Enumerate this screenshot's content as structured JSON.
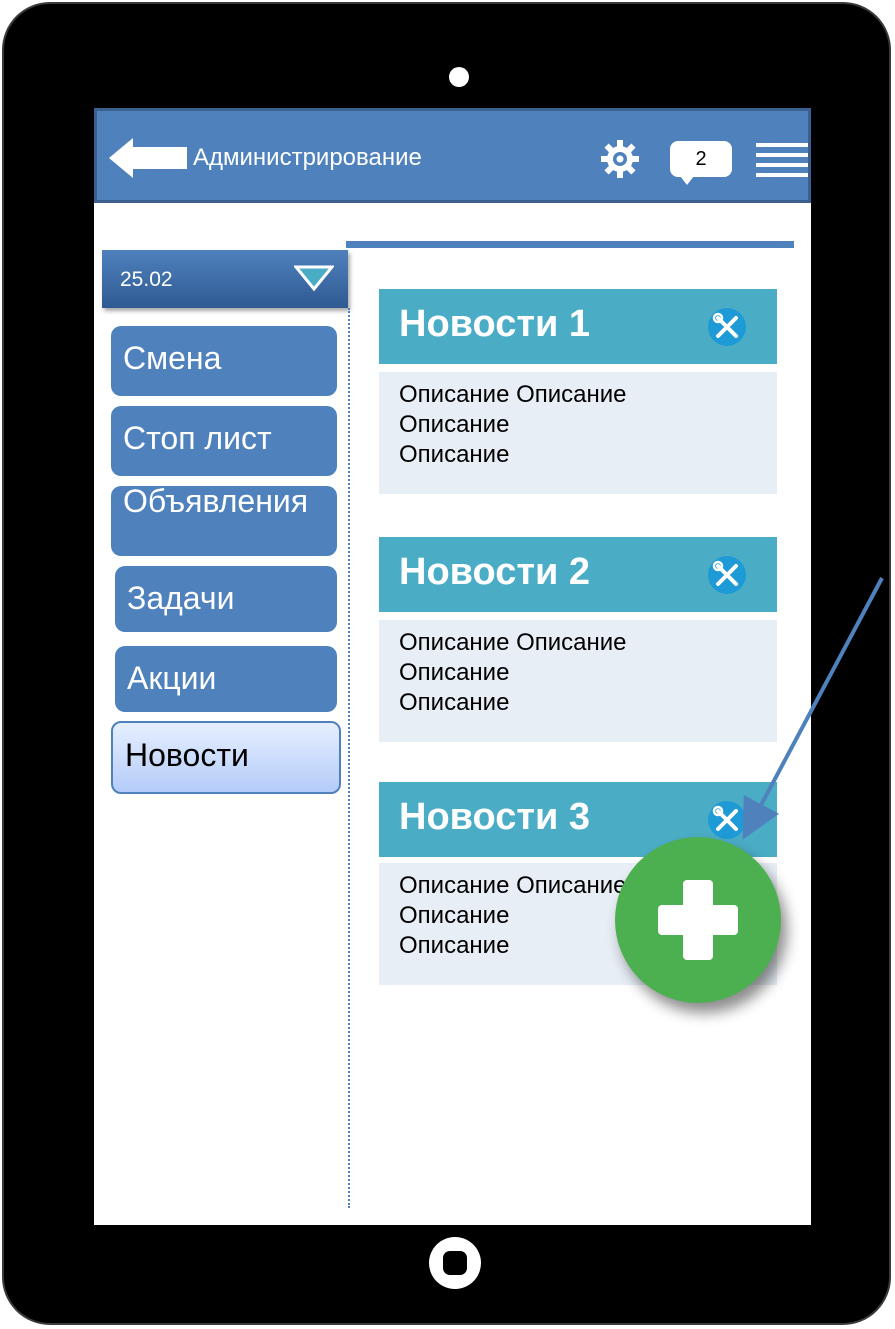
{
  "header": {
    "title": "Администрирование",
    "badge_count": "2",
    "icons": [
      "back-arrow-icon",
      "gear-icon",
      "chat-badge-icon",
      "hamburger-menu-icon"
    ]
  },
  "date_dropdown": {
    "selected": "25.02"
  },
  "sidebar": {
    "items": [
      {
        "label": "Смена"
      },
      {
        "label": "Стоп лист"
      },
      {
        "label": "Объявления"
      },
      {
        "label": "Задачи"
      },
      {
        "label": "Акции"
      },
      {
        "label": "Новости",
        "active": true
      }
    ]
  },
  "news": [
    {
      "title": "Новости 1",
      "lines": [
        "Описание Описание",
        "Описание",
        "Описание"
      ]
    },
    {
      "title": "Новости 2",
      "lines": [
        "Описание Описание",
        "Описание",
        "Описание"
      ]
    },
    {
      "title": "Новости 3",
      "lines": [
        "Описание Описание",
        "Описание",
        "Описание"
      ]
    }
  ],
  "colors": {
    "header": "#4f81bd",
    "news_header": "#4bacc6",
    "news_body": "#e7eef5",
    "fab": "#4caf50",
    "tool_icon": "#1e9ad6"
  }
}
